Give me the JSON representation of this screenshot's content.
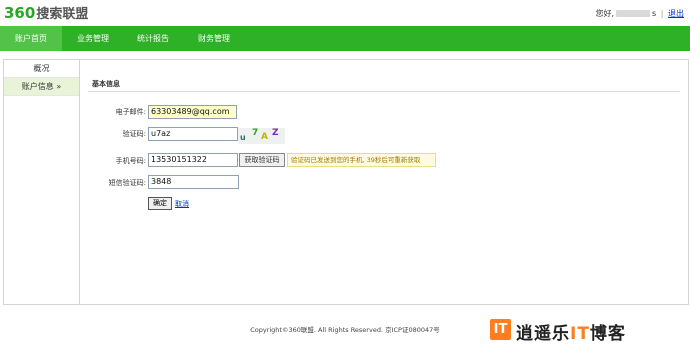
{
  "header": {
    "logo_num": "360",
    "logo_text": "搜索联盟",
    "greeting": "您好,",
    "user_suffix": "s",
    "logout": "退出",
    "separator": "|"
  },
  "nav": {
    "items": [
      {
        "label": "账户首页"
      },
      {
        "label": "业务管理"
      },
      {
        "label": "统计报告"
      },
      {
        "label": "财务管理"
      }
    ]
  },
  "sidebar": {
    "items": [
      {
        "label": "概况"
      },
      {
        "label": "账户信息 »"
      }
    ]
  },
  "form": {
    "section_title": "基本信息",
    "email": {
      "label": "电子邮件:",
      "value": "63303489@qq.com"
    },
    "captcha": {
      "label": "验证码:",
      "value": "u7az",
      "chars": [
        "u",
        "7",
        "A",
        "Z"
      ]
    },
    "phone": {
      "label": "手机号码:",
      "value": "13530151322",
      "get_code_button": "获取验证码",
      "tip": "验证码已发送到您的手机, 39秒后可重新获取"
    },
    "sms": {
      "label": "短信验证码:",
      "value": "3848"
    },
    "confirm_button": "确定",
    "cancel_link": "取消"
  },
  "footer": {
    "copyright": "Copyright©360联盟. All Rights Reserved. 京ICP证080047号"
  },
  "watermark": {
    "icon_text": "IT",
    "text_a": "逍遥乐",
    "text_b": "IT",
    "text_c": "博客"
  },
  "colors": {
    "nav_green": "#2fb127",
    "nav_active": "#52c249",
    "sidebar_active": "#e8f3d8",
    "link_blue": "#0033cc",
    "watermark_orange": "#ff7d1f"
  }
}
